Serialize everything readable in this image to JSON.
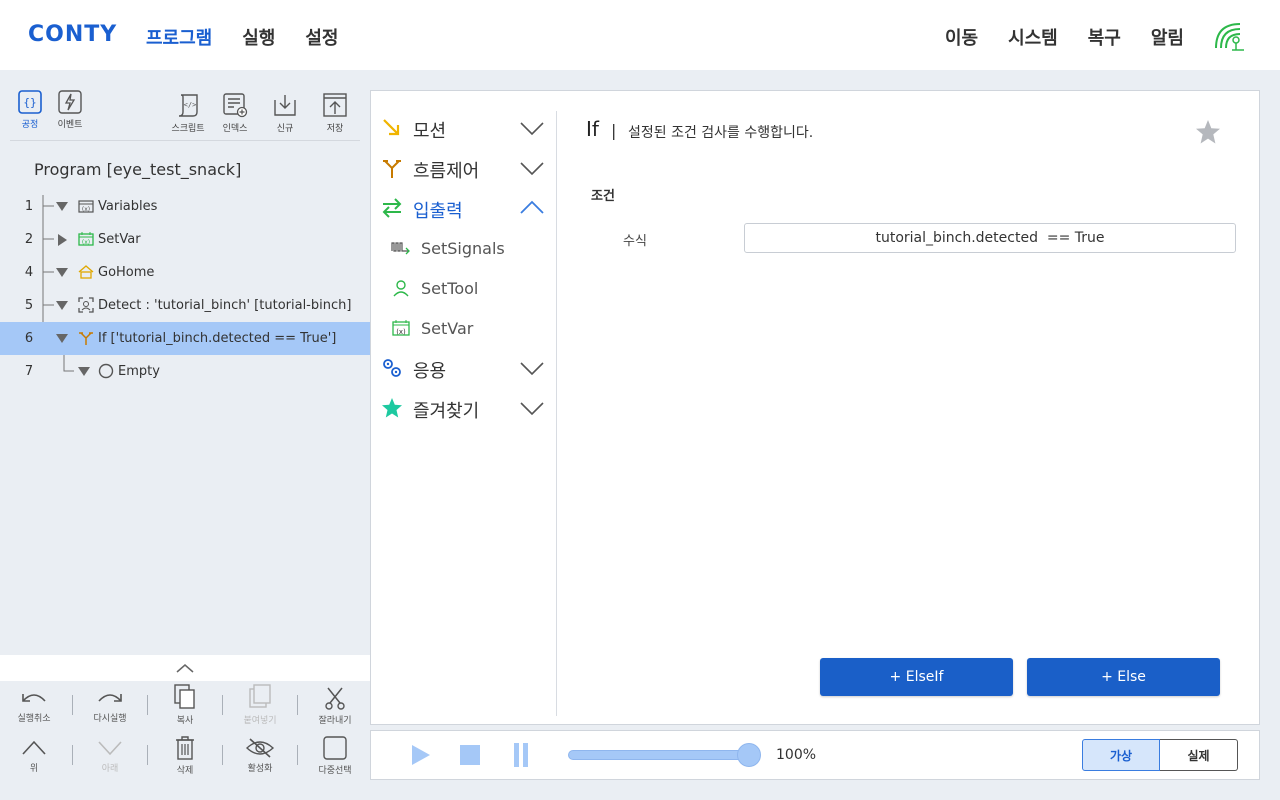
{
  "header": {
    "logo": "CONTY",
    "nav_left": [
      "프로그램",
      "실행",
      "설정"
    ],
    "nav_right": [
      "이동",
      "시스템",
      "복구",
      "알림"
    ]
  },
  "left_toolbar": {
    "command": "공정",
    "event": "이벤트",
    "script": "스크립트",
    "index": "인덱스",
    "new": "신규",
    "save": "저장"
  },
  "program": {
    "title": "Program [eye_test_snack]",
    "rows": [
      {
        "num": "1",
        "label": "Variables"
      },
      {
        "num": "2",
        "label": "SetVar"
      },
      {
        "num": "4",
        "label": "GoHome"
      },
      {
        "num": "5",
        "label": "Detect : 'tutorial_binch' [tutorial-binch]"
      },
      {
        "num": "6",
        "label": "If ['tutorial_binch.detected == True']"
      },
      {
        "num": "7",
        "label": "Empty"
      }
    ]
  },
  "edit_bar": {
    "undo": "실행취소",
    "redo": "다시실행",
    "copy": "복사",
    "paste": "붙여넣기",
    "cut": "잘라내기",
    "up": "위",
    "down": "아래",
    "delete": "삭제",
    "activate": "활성화",
    "multi_select": "다중선택"
  },
  "categories": {
    "motion": "모션",
    "flow": "흐름제어",
    "io": "입출력",
    "io_items": [
      "SetSignals",
      "SetTool",
      "SetVar"
    ],
    "app": "응용",
    "favorites": "즐겨찾기"
  },
  "detail": {
    "title": "If",
    "separator": "|",
    "description": "설정된 조건 검사를 수행합니다.",
    "section": "조건",
    "field_label": "수식",
    "field_value": "tutorial_binch.detected  == True",
    "elseif_button": "+ ElseIf",
    "else_button": "+ Else"
  },
  "player": {
    "speed": "100%",
    "speed_fraction": 1.0,
    "mode_virtual": "가상",
    "mode_real": "실제"
  },
  "colors": {
    "accent": "#1a5fd0",
    "selected_row": "#a5c8f7",
    "button": "#1a5fc8"
  }
}
